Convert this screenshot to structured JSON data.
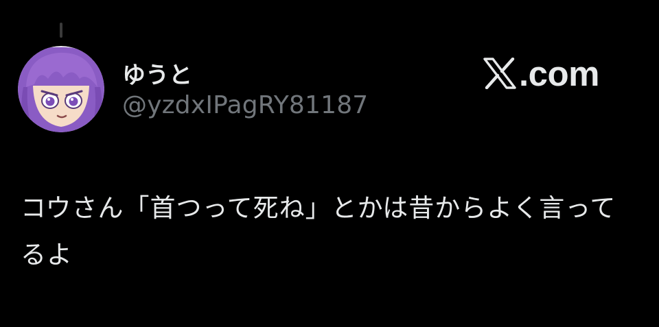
{
  "post": {
    "display_name": "ゆうと",
    "handle": "@yzdxIPagRY81187",
    "text": "コウさん「首つって死ね」とかは昔からよく言ってるよ"
  },
  "brand": {
    "logo_icon": "x-logo-icon",
    "domain_suffix": ".com"
  },
  "colors": {
    "background": "#000000",
    "primary_text": "#e7e9ea",
    "secondary_text": "#71767b",
    "avatar_accent": "#8a5cc4"
  }
}
